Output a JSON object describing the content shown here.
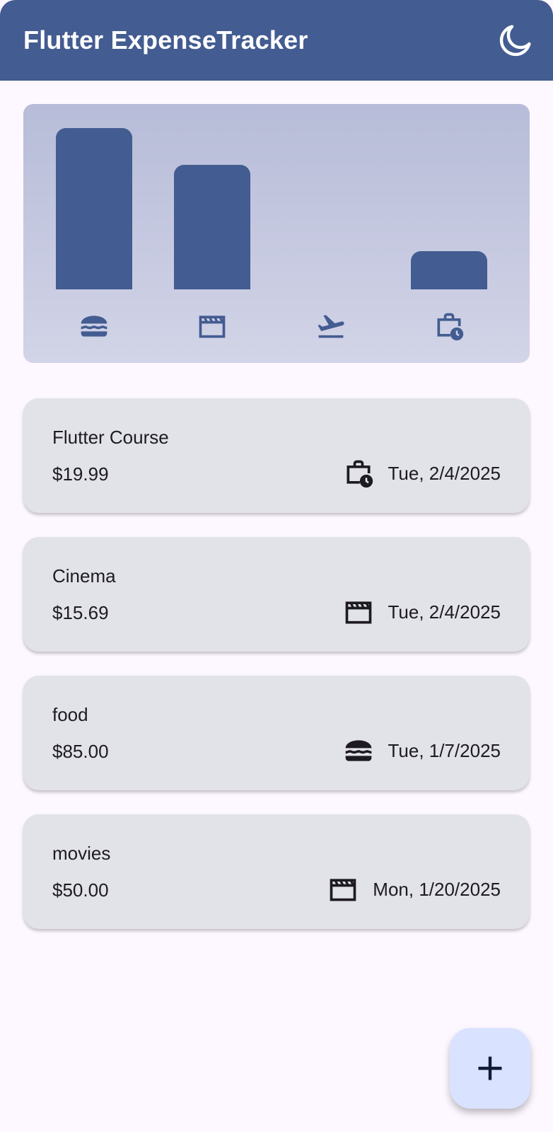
{
  "app_bar": {
    "title": "Flutter ExpenseTracker",
    "theme_toggle_icon": "moon-icon"
  },
  "colors": {
    "primary": "#435c91",
    "background": "#fdf7ff",
    "card": "#e2e2e9",
    "fab": "#d9e2ff"
  },
  "chart_data": {
    "type": "bar",
    "categories": [
      "food",
      "leisure",
      "travel",
      "work"
    ],
    "category_icons": [
      "burger-icon",
      "clapperboard-icon",
      "flight-takeoff-icon",
      "work-history-icon"
    ],
    "values": [
      85.0,
      65.69,
      0,
      19.99
    ],
    "ylim": [
      0,
      85.0
    ]
  },
  "expenses": [
    {
      "title": "Flutter Course",
      "amount": "$19.99",
      "category_icon": "work-history-icon",
      "date": "Tue, 2/4/2025"
    },
    {
      "title": "Cinema",
      "amount": "$15.69",
      "category_icon": "clapperboard-icon",
      "date": "Tue, 2/4/2025"
    },
    {
      "title": "food",
      "amount": "$85.00",
      "category_icon": "burger-icon",
      "date": "Tue, 1/7/2025"
    },
    {
      "title": "movies",
      "amount": "$50.00",
      "category_icon": "clapperboard-icon",
      "date": "Mon, 1/20/2025"
    }
  ],
  "fab": {
    "icon": "plus-icon"
  }
}
